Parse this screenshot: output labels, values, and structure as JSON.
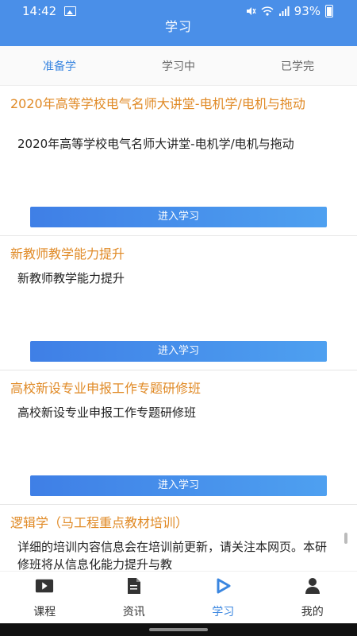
{
  "status": {
    "time": "14:42",
    "battery": "93%"
  },
  "header": {
    "title": "学习"
  },
  "tabs": [
    {
      "label": "准备学"
    },
    {
      "label": "学习中"
    },
    {
      "label": "已学完"
    }
  ],
  "courses": [
    {
      "title": "2020年高等学校电气名师大讲堂-电机学/电机与拖动",
      "description": "2020年高等学校电气名师大讲堂-电机学/电机与拖动",
      "button": "进入学习"
    },
    {
      "title": "新教师教学能力提升",
      "description": "新教师教学能力提升",
      "button": "进入学习"
    },
    {
      "title": "高校新设专业申报工作专题研修班",
      "description": "高校新设专业申报工作专题研修班",
      "button": "进入学习"
    },
    {
      "title": "逻辑学（马工程重点教材培训）",
      "description": "详细的培训内容信息会在培训前更新，请关注本网页。本研修班将从信息化能力提升与教"
    }
  ],
  "bottom_nav": [
    {
      "label": "课程",
      "icon": "video-icon"
    },
    {
      "label": "资讯",
      "icon": "document-icon"
    },
    {
      "label": "学习",
      "icon": "play-icon"
    },
    {
      "label": "我的",
      "icon": "person-icon"
    }
  ],
  "colors": {
    "header": "#4a8fe8",
    "accent": "#3a86e0",
    "course_title": "#e08a26"
  }
}
